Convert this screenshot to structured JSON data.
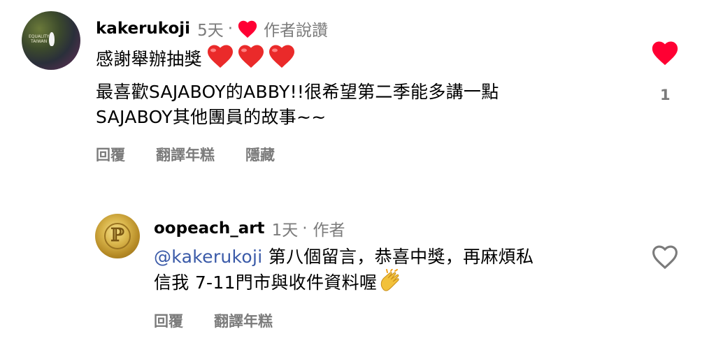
{
  "comments": [
    {
      "username": "kakerukoji",
      "time": "5天",
      "separator": "·",
      "author_like": "作者說讚",
      "line1": "感謝舉辦抽獎",
      "line2": "最喜歡SAJABOY的ABBY!!很希望第二季能多講一點",
      "line3": "SAJABOY其他團員的故事~~",
      "actions": {
        "reply": "回覆",
        "translate": "翻譯年糕",
        "hide": "隱藏"
      },
      "liked": true,
      "like_count": "1",
      "heart_color": "#ff0033",
      "avatar_text": [
        "EQUALITY",
        "TAIWAN"
      ]
    },
    {
      "username": "oopeach_art",
      "time": "1天",
      "separator": "·",
      "author_tag": "作者",
      "mention": "@kakerukoji",
      "line1_rest": " 第八個留言，恭喜中獎，再麻煩私",
      "line2": "信我 7-11門市與收件資料喔",
      "emoji": "👏",
      "actions": {
        "reply": "回覆",
        "translate": "翻譯年糕"
      },
      "liked": false
    }
  ],
  "colors": {
    "muted": "#7b7b7b",
    "mention": "#3a5aa8",
    "like_red": "#ff0033"
  }
}
